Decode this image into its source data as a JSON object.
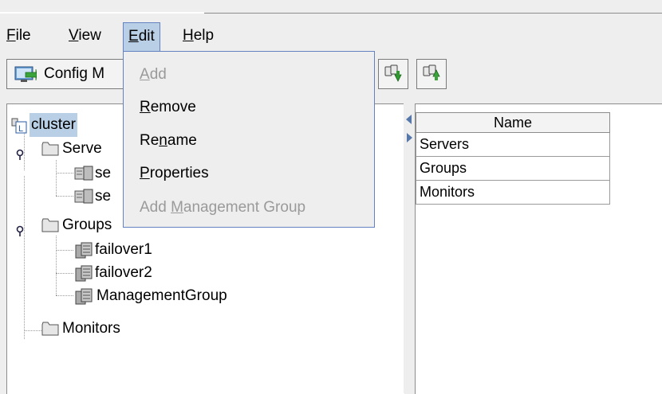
{
  "menubar": {
    "file": {
      "pre": "",
      "key": "F",
      "post": "ile"
    },
    "view": {
      "pre": "",
      "key": "V",
      "post": "iew"
    },
    "edit": {
      "pre": "",
      "key": "E",
      "post": "dit"
    },
    "help": {
      "pre": "",
      "key": "H",
      "post": "elp"
    }
  },
  "toolbar": {
    "config_label": "Config M"
  },
  "edit_menu": {
    "items": [
      {
        "pre": "",
        "key": "A",
        "post": "dd",
        "enabled": false
      },
      {
        "pre": "",
        "key": "R",
        "post": "emove",
        "enabled": true
      },
      {
        "pre": "Re",
        "key": "n",
        "post": "ame",
        "enabled": true
      },
      {
        "pre": "",
        "key": "P",
        "post": "roperties",
        "enabled": true
      },
      {
        "pre": "Add ",
        "key": "M",
        "post": "anagement Group",
        "enabled": false
      }
    ]
  },
  "tree": {
    "root": "cluster",
    "servers_folder": "Serve",
    "server1": "se",
    "server2": "se",
    "groups_folder": "Groups",
    "group1": "failover1",
    "group2": "failover2",
    "group3": "ManagementGroup",
    "monitors_folder": "Monitors"
  },
  "table": {
    "header": "Name",
    "rows": [
      "Servers",
      "Groups",
      "Monitors"
    ]
  }
}
